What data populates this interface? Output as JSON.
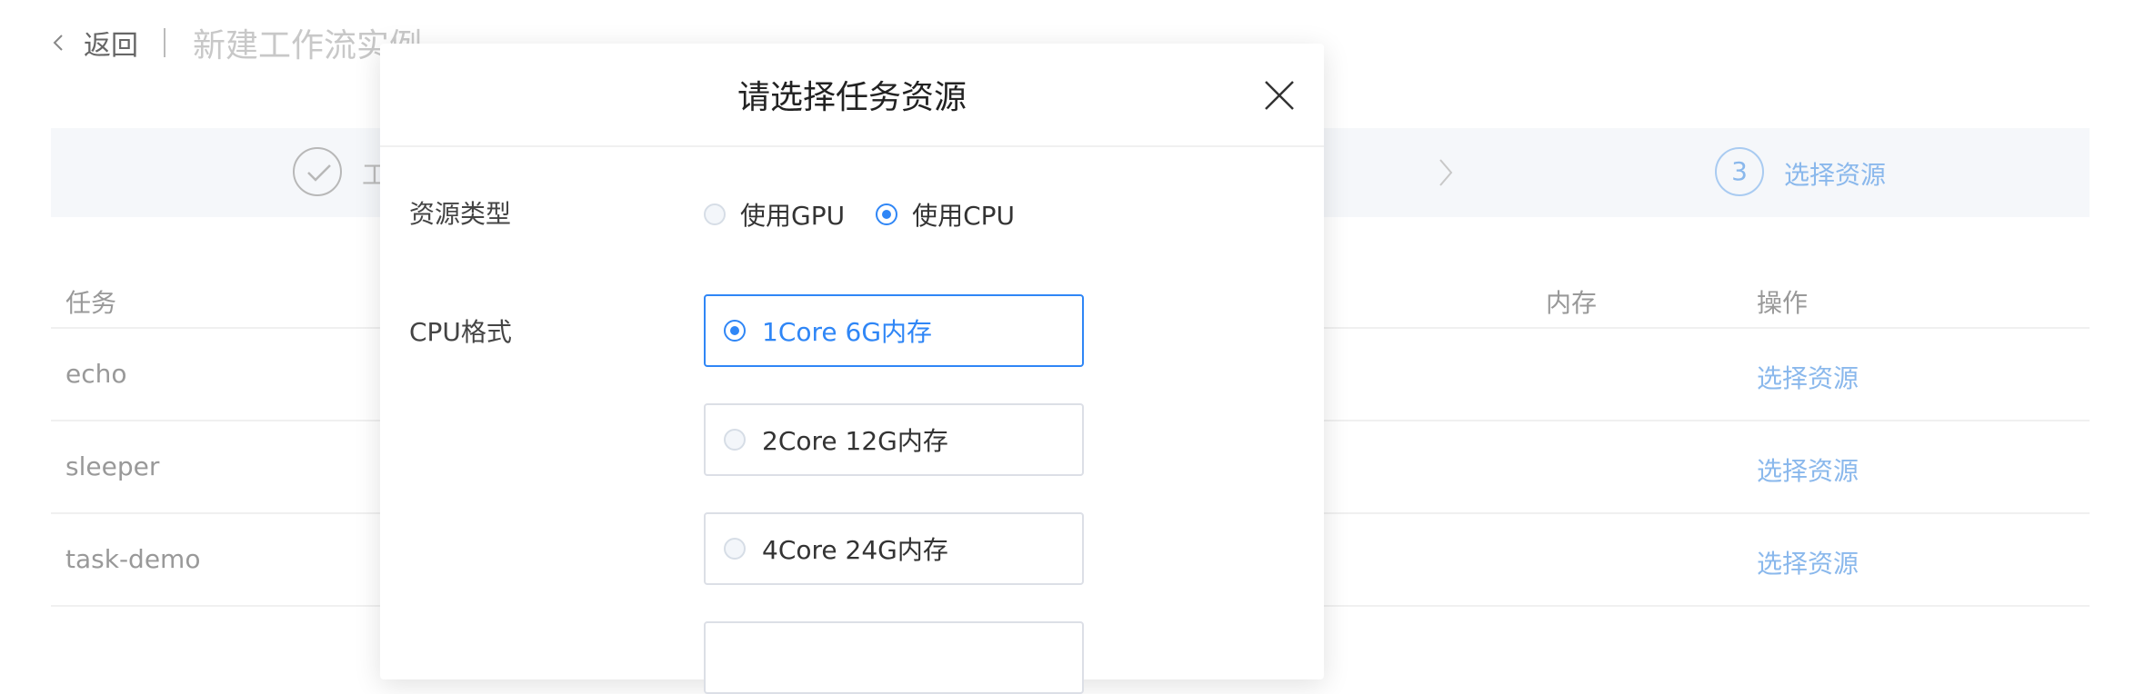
{
  "page": {
    "back_label": "返回",
    "title": "新建工作流实例"
  },
  "steps": {
    "step1_label": "工",
    "step3_number": "3",
    "step3_label": "选择资源"
  },
  "table": {
    "headers": {
      "task": "任务",
      "memory": "内存",
      "action": "操作"
    },
    "rows": [
      {
        "task": "echo",
        "action": "选择资源"
      },
      {
        "task": "sleeper",
        "action": "选择资源"
      },
      {
        "task": "task-demo",
        "action": "选择资源"
      }
    ]
  },
  "modal": {
    "title": "请选择任务资源",
    "resource_type_label": "资源类型",
    "resource_type_options": [
      "使用GPU",
      "使用CPU"
    ],
    "resource_type_selected": "使用CPU",
    "cpu_format_label": "CPU格式",
    "cpu_options": [
      "1Core 6G内存",
      "2Core 12G内存",
      "4Core 24G内存"
    ],
    "cpu_selected": "1Core 6G内存"
  },
  "colors": {
    "accent": "#2f86f6",
    "accent_light": "#8ab8ec",
    "muted_text": "#999999"
  },
  "icons": {
    "back": "chevron-left-icon",
    "step_done": "check-icon",
    "step_arrow": "chevron-right-icon",
    "close": "close-icon"
  }
}
